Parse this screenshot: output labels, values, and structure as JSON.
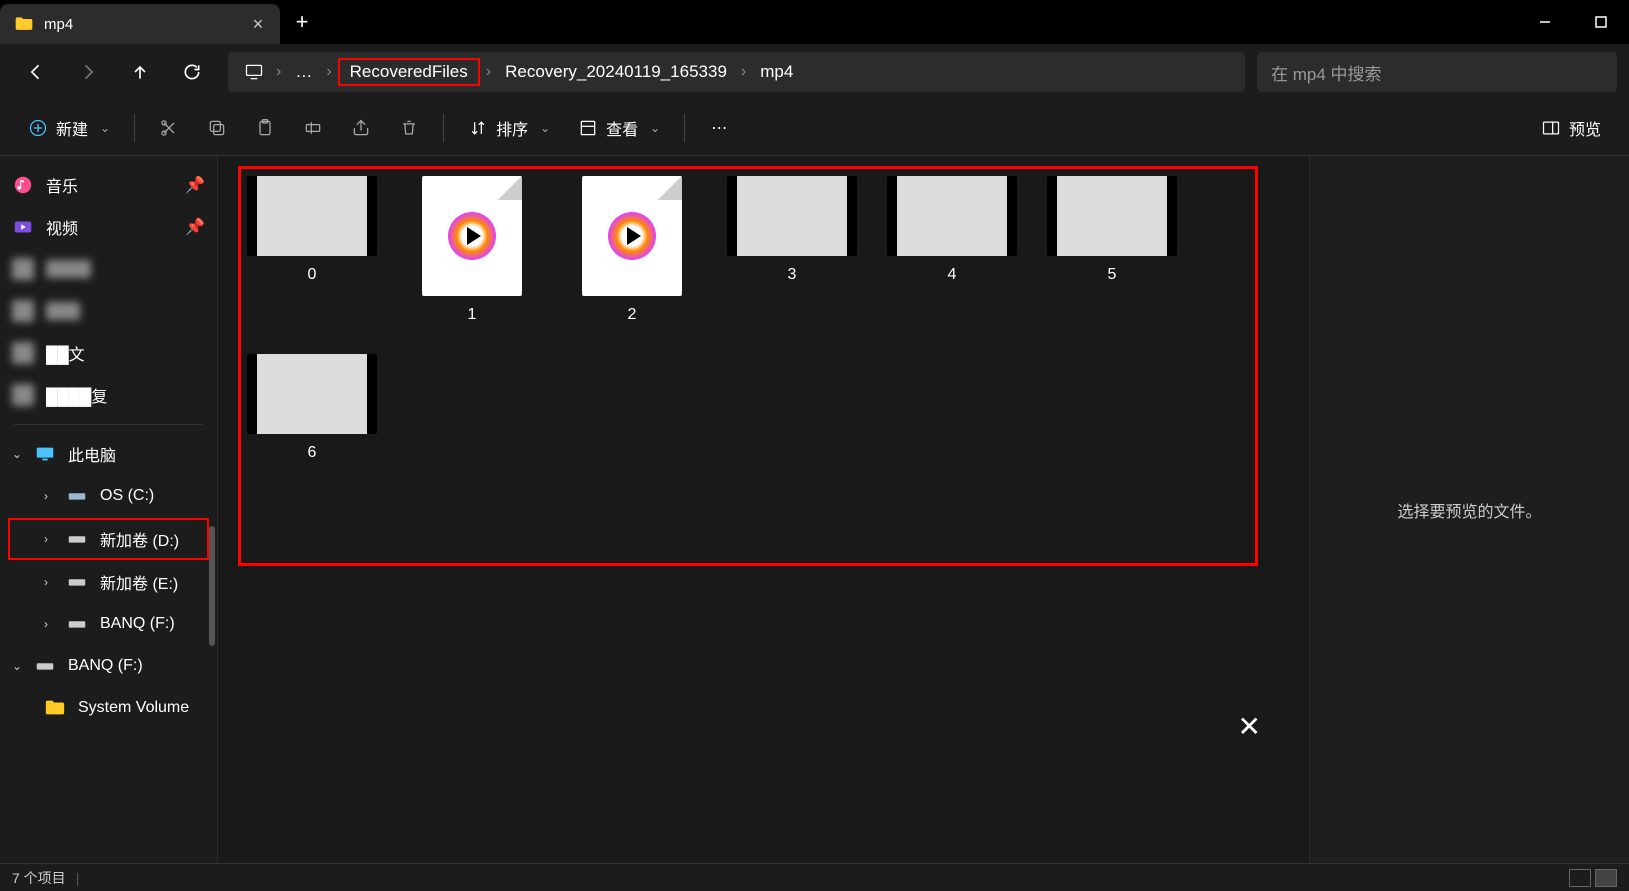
{
  "tab": {
    "title": "mp4"
  },
  "breadcrumb": {
    "seg1": "RecoveredFiles",
    "seg2": "Recovery_20240119_165339",
    "seg3": "mp4"
  },
  "search": {
    "placeholder": "在 mp4 中搜索"
  },
  "toolbar": {
    "new": "新建",
    "sort": "排序",
    "view": "查看",
    "preview": "预览"
  },
  "sidebar": {
    "music": "音乐",
    "video": "视频",
    "blurred1": "████",
    "blurred2": "███",
    "blurred3": "██文",
    "blurred4": "████复",
    "thispc": "此电脑",
    "drive_c": "OS (C:)",
    "drive_d": "新加卷 (D:)",
    "drive_e": "新加卷 (E:)",
    "drive_f": "BANQ (F:)",
    "drive_f2": "BANQ (F:)",
    "sysvol": "System Volume"
  },
  "files": [
    {
      "name": "0",
      "type": "video-thumb",
      "variant": "cook"
    },
    {
      "name": "1",
      "type": "media-doc"
    },
    {
      "name": "2",
      "type": "media-doc"
    },
    {
      "name": "3",
      "type": "video-thumb",
      "variant": "doc-text"
    },
    {
      "name": "4",
      "type": "video-thumb",
      "variant": "fire"
    },
    {
      "name": "5",
      "type": "video-thumb",
      "variant": "ppl"
    },
    {
      "name": "6",
      "type": "video-thumb",
      "variant": "ppl"
    }
  ],
  "preview_empty": "选择要预览的文件。",
  "status": {
    "count": "7 个项目"
  }
}
